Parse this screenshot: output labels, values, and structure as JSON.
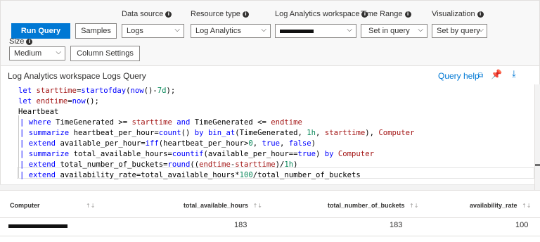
{
  "toolbar": {
    "run_query_label": "Run Query",
    "samples_label": "Samples",
    "data_source": {
      "label": "Data source",
      "value": "Logs"
    },
    "resource_type": {
      "label": "Resource type",
      "value": "Log Analytics"
    },
    "workspace": {
      "label": "Log Analytics workspace",
      "value": ""
    },
    "time_range": {
      "label": "Time Range",
      "value": "Set in query"
    },
    "visualization": {
      "label": "Visualization",
      "value": "Set by query"
    },
    "size": {
      "label": "Size",
      "value": "Medium"
    },
    "column_settings_label": "Column Settings",
    "info_glyph": "i",
    "chevron_glyph": "⌵"
  },
  "query_panel": {
    "title": "Log Analytics workspace Logs Query",
    "help_label": "Query help",
    "external_icon": "⧉",
    "pin_icon": "📌",
    "download_icon": "⤓"
  },
  "code_lines": [
    "let starttime=startofday(now()-7d);",
    "let endtime=now();",
    "Heartbeat",
    "| where TimeGenerated >= starttime and TimeGenerated <= endtime",
    "| summarize heartbeat_per_hour=count() by bin_at(TimeGenerated, 1h, starttime), Computer",
    "| extend available_per_hour=iff(heartbeat_per_hour>0, true, false)",
    "| summarize total_available_hours=countif(available_per_hour==true) by Computer",
    "| extend total_number_of_buckets=round((endtime-starttime)/1h)",
    "| extend availability_rate=total_available_hours*100/total_number_of_buckets"
  ],
  "results": {
    "columns": [
      "Computer",
      "total_available_hours",
      "total_number_of_buckets",
      "availability_rate"
    ],
    "sort_glyph": "↑↓",
    "rows": [
      {
        "computer": "",
        "total_available_hours": "183",
        "total_number_of_buckets": "183",
        "availability_rate": "100"
      }
    ]
  },
  "colors": {
    "primary": "#0078d4",
    "keyword": "#0000ff",
    "string": "#a31515",
    "number": "#09885a"
  }
}
